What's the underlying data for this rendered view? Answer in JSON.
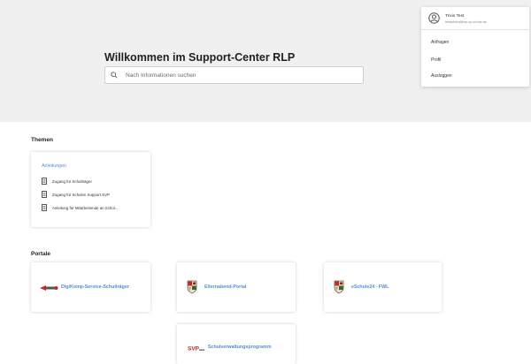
{
  "hero": {
    "title": "Willkommen im Support-Center RLP",
    "search_placeholder": "Nach Informationen suchen"
  },
  "user_menu": {
    "name": "Trixis Test",
    "email": "testadmin@bsp-rlp.schule.de",
    "items": [
      "Anfragen",
      "Profil",
      "Ausloggen"
    ]
  },
  "themen": {
    "title": "Themen",
    "card": {
      "link": "Anleitungen",
      "docs": [
        "Zugang für Schulträger",
        "Zugang für Schulen Support SVP",
        "Anleitung für Mitarbeitende an Schul..."
      ]
    }
  },
  "portale": {
    "title": "Portale",
    "cards": [
      {
        "label": "DigiKomp-Service-Schulträger",
        "logo": "digikomp-logo"
      },
      {
        "label": "Elternabend-Portal",
        "logo": "rlp-crest-logo"
      },
      {
        "label": "eSchule24 - FWL",
        "logo": "rlp-crest-logo"
      },
      {
        "label": "Schulverwaltungsprogramm",
        "logo": "svp-logo"
      }
    ]
  },
  "colors": {
    "accent": "#4d8edb",
    "hero_bg": "#f0f0f0"
  }
}
